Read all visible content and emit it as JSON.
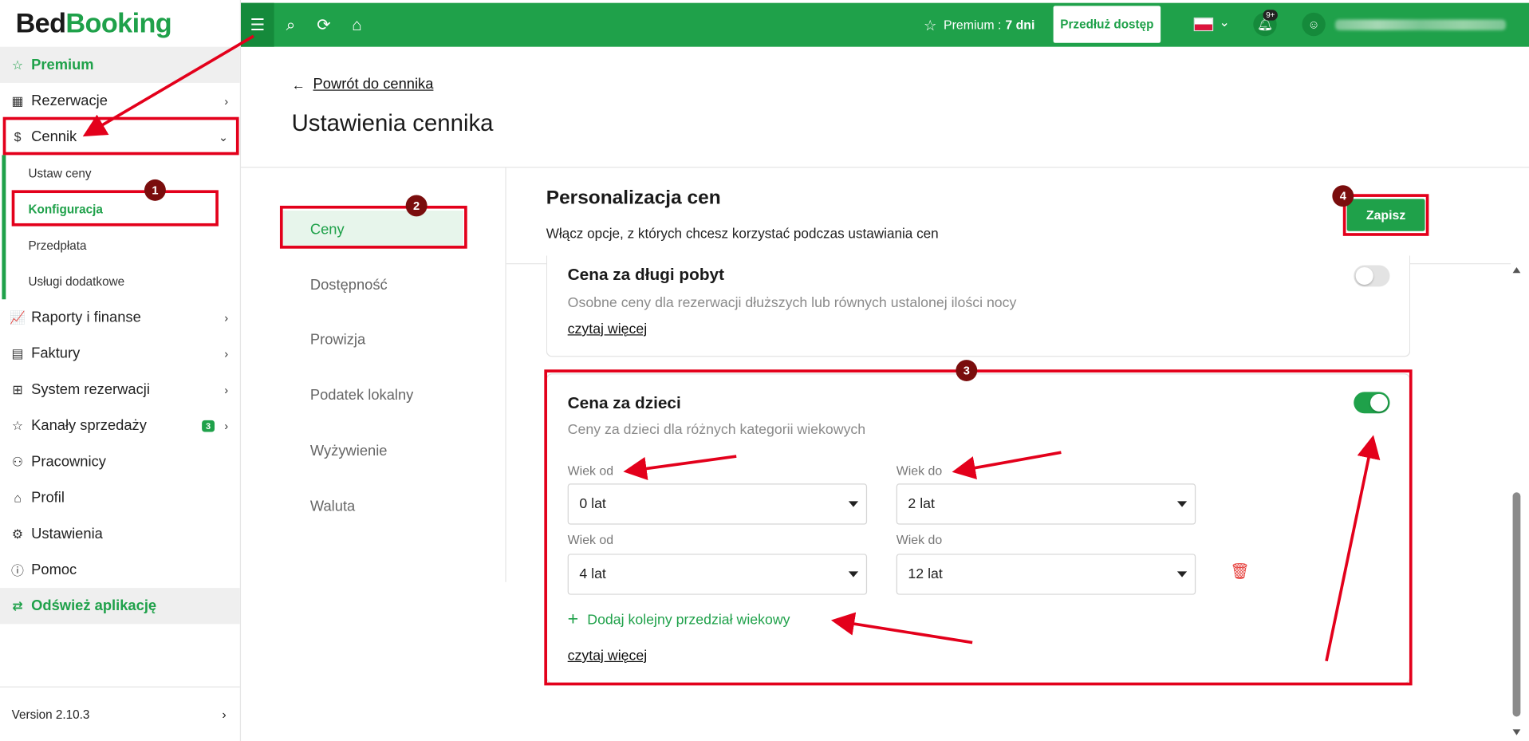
{
  "app": {
    "logo_part1": "Bed",
    "logo_part2": "Booking",
    "version": "Version 2.10.3"
  },
  "sidebar": {
    "premium": "Premium",
    "items": [
      {
        "label": "Rezerwacje",
        "icon": "calendar-icon"
      },
      {
        "label": "Cennik",
        "icon": "dollar-icon"
      },
      {
        "label": "Raporty i finanse",
        "icon": "chart-icon"
      },
      {
        "label": "Faktury",
        "icon": "invoice-icon"
      },
      {
        "label": "System rezerwacji",
        "icon": "grid-icon"
      },
      {
        "label": "Kanały sprzedaży",
        "icon": "star-icon",
        "badge": "3"
      },
      {
        "label": "Pracownicy",
        "icon": "user-add-icon"
      },
      {
        "label": "Profil",
        "icon": "building-icon"
      },
      {
        "label": "Ustawienia",
        "icon": "gear-icon"
      },
      {
        "label": "Pomoc",
        "icon": "info-icon"
      }
    ],
    "cennik_sub": [
      "Ustaw ceny",
      "Konfiguracja",
      "Przedpłata",
      "Usługi dodatkowe"
    ],
    "refresh": "Odśwież aplikację"
  },
  "topbar": {
    "premium_label": "Premium :",
    "premium_days": "7 dni",
    "extend_label": "Przedłuż dostęp",
    "notifications": "9+"
  },
  "page": {
    "back_link": "Powrót do cennika",
    "title": "Ustawienia cennika",
    "tabs": [
      "Ceny",
      "Dostępność",
      "Prowizja",
      "Podatek lokalny",
      "Wyżywienie",
      "Waluta"
    ],
    "active_tab": "Ceny"
  },
  "panel": {
    "title": "Personalizacja cen",
    "subtitle": "Włącz opcje, z których chcesz korzystać podczas ustawiania cen",
    "save_label": "Zapisz"
  },
  "long_stay": {
    "title": "Cena za długi pobyt",
    "desc": "Osobne ceny dla rezerwacji dłuższych lub równych ustalonej ilości nocy",
    "read_more": "czytaj więcej",
    "enabled": false
  },
  "children": {
    "title": "Cena za dzieci",
    "desc": "Ceny za dzieci dla różnych kategorii wiekowych",
    "enabled": true,
    "age_from_label": "Wiek od",
    "age_to_label": "Wiek do",
    "ranges": [
      {
        "from": "0 lat",
        "to": "2 lat"
      },
      {
        "from": "4 lat",
        "to": "12 lat"
      }
    ],
    "add_range": "Dodaj kolejny przedział wiekowy",
    "read_more": "czytaj więcej"
  },
  "annotations": {
    "numbers": [
      "1",
      "2",
      "3",
      "4"
    ],
    "color": "#e3001b"
  },
  "colors": {
    "accent": "#1fa14a",
    "danger": "#e53935"
  }
}
